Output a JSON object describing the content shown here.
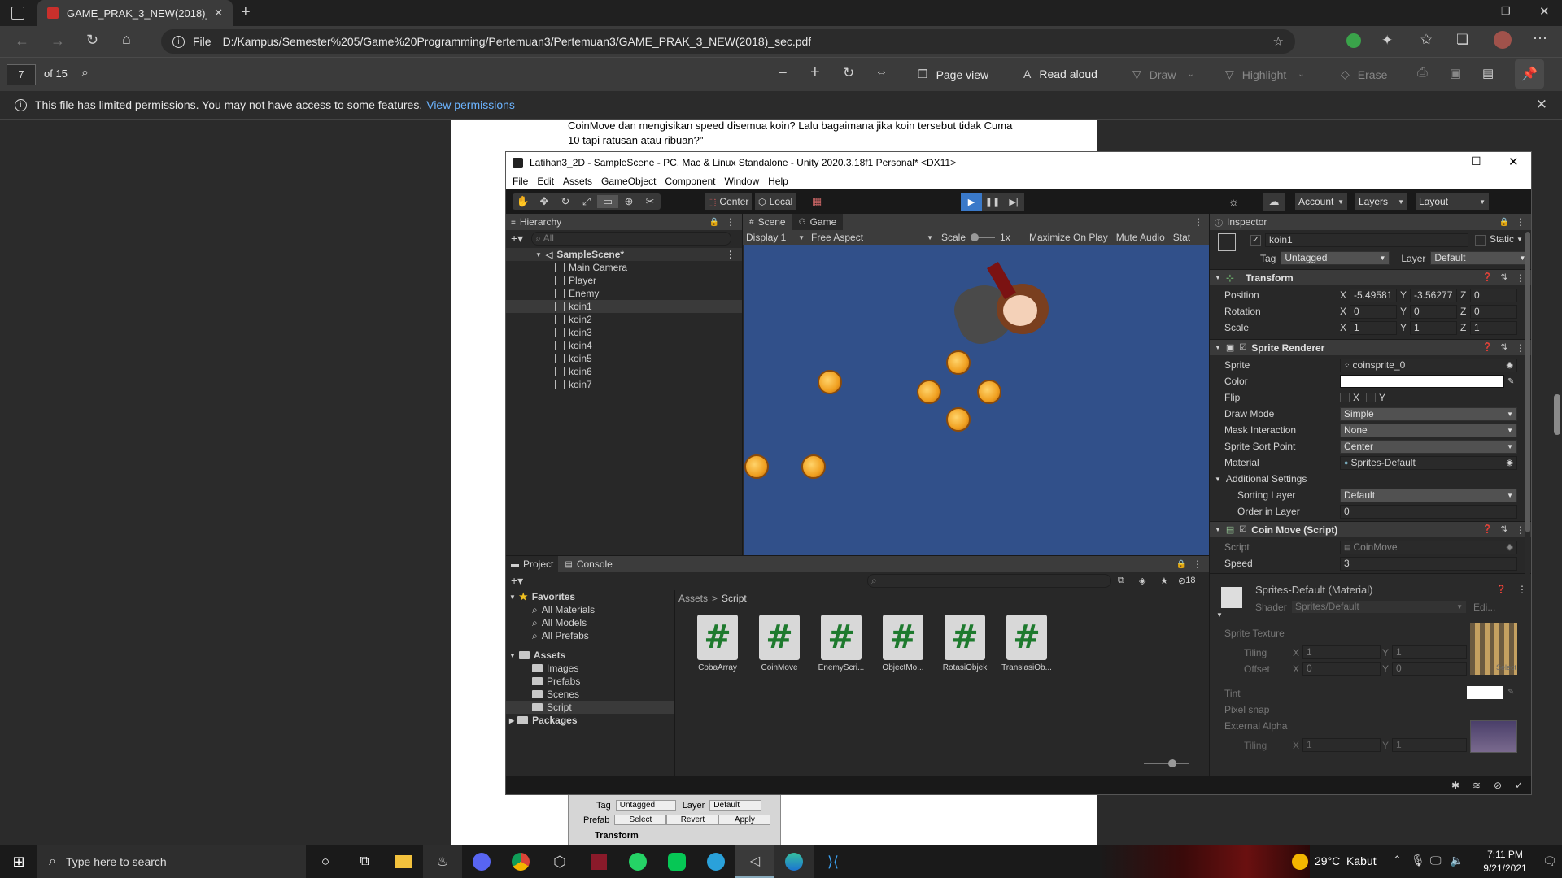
{
  "browser": {
    "tab_title": "GAME_PRAK_3_NEW(2018)_sec.p",
    "url_prefix": "File",
    "url": "D:/Kampus/Semester%205/Game%20Programming/Pertemuan3/Pertemuan3/GAME_PRAK_3_NEW(2018)_sec.pdf"
  },
  "pdf_toolbar": {
    "page_number": "7",
    "page_total": "of 15",
    "page_view": "Page view",
    "read_aloud": "Read aloud",
    "draw": "Draw",
    "highlight": "Highlight",
    "erase": "Erase"
  },
  "permission_bar": {
    "message": "This file has limited permissions. You may not have access to some features.",
    "link": "View permissions"
  },
  "pdf_page": {
    "text_line1": "CoinMove dan mengisikan speed disemua koin? Lalu bagaimana jika koin tersebut tidak Cuma",
    "text_line2": "10 tapi ratusan atau ribuan?\"",
    "bottom_tag_label": "Tag",
    "bottom_tag_value": "Untagged",
    "bottom_layer_label": "Layer",
    "bottom_layer_value": "Default",
    "bottom_prefab_label": "Prefab",
    "bottom_select": "Select",
    "bottom_revert": "Revert",
    "bottom_apply": "Apply",
    "bottom_transform": "Transform"
  },
  "unity": {
    "title": "Latihan3_2D - SampleScene - PC, Mac & Linux Standalone - Unity 2020.3.18f1 Personal* <DX11>",
    "menu": [
      "File",
      "Edit",
      "Assets",
      "GameObject",
      "Component",
      "Window",
      "Help"
    ],
    "toolbar": {
      "center": "Center",
      "local": "Local",
      "account": "Account",
      "layers": "Layers",
      "layout": "Layout"
    },
    "hierarchy": {
      "title": "Hierarchy",
      "search_placeholder": "All",
      "scene": "SampleScene*",
      "items": [
        "Main Camera",
        "Player",
        "Enemy",
        "koin1",
        "koin2",
        "koin3",
        "koin4",
        "koin5",
        "koin6",
        "koin7"
      ]
    },
    "game_view": {
      "tab_scene": "Scene",
      "tab_game": "Game",
      "display": "Display 1",
      "aspect": "Free Aspect",
      "scale_label": "Scale",
      "scale_value": "1x",
      "maximize": "Maximize On Play",
      "mute": "Mute Audio",
      "stats": "Stat",
      "background": "#31508a"
    },
    "project": {
      "tab_project": "Project",
      "tab_console": "Console",
      "favorites": "Favorites",
      "fav_items": [
        "All Materials",
        "All Models",
        "All Prefabs"
      ],
      "assets": "Assets",
      "asset_folders": [
        "Images",
        "Prefabs",
        "Scenes",
        "Script"
      ],
      "packages": "Packages",
      "breadcrumb_root": "Assets",
      "breadcrumb_leaf": "Script",
      "count": "18",
      "scripts": [
        "CobaArray",
        "CoinMove",
        "EnemyScri...",
        "ObjectMo...",
        "RotasiObjek",
        "TranslasiOb..."
      ]
    },
    "inspector": {
      "title": "Inspector",
      "object_name": "koin1",
      "static": "Static",
      "tag_label": "Tag",
      "tag_value": "Untagged",
      "layer_label": "Layer",
      "layer_value": "Default",
      "transform": {
        "title": "Transform",
        "position_label": "Position",
        "pos_x": "-5.49581",
        "pos_y": "-3.56277",
        "pos_z": "0",
        "rotation_label": "Rotation",
        "rot_x": "0",
        "rot_y": "0",
        "rot_z": "0",
        "scale_label": "Scale",
        "scale_x": "1",
        "scale_y": "1",
        "scale_z": "1"
      },
      "sprite_renderer": {
        "title": "Sprite Renderer",
        "sprite_label": "Sprite",
        "sprite_value": "coinsprite_0",
        "color_label": "Color",
        "flip_label": "Flip",
        "flip_x": "X",
        "flip_y": "Y",
        "draw_mode_label": "Draw Mode",
        "draw_mode_value": "Simple",
        "mask_label": "Mask Interaction",
        "mask_value": "None",
        "sort_point_label": "Sprite Sort Point",
        "sort_point_value": "Center",
        "material_label": "Material",
        "material_value": "Sprites-Default",
        "additional": "Additional Settings",
        "sorting_layer_label": "Sorting Layer",
        "sorting_layer_value": "Default",
        "order_label": "Order in Layer",
        "order_value": "0"
      },
      "coin_move": {
        "title": "Coin Move (Script)",
        "script_label": "Script",
        "script_value": "CoinMove",
        "speed_label": "Speed",
        "speed_value": "3"
      },
      "material": {
        "title": "Sprites-Default (Material)",
        "shader_label": "Shader",
        "shader_value": "Sprites/Default",
        "edit": "Edi...",
        "sprite_texture": "Sprite Texture",
        "tiling": "Tiling",
        "tiling_x": "1",
        "tiling_y": "1",
        "offset": "Offset",
        "offset_x": "0",
        "offset_y": "0",
        "select": "Select",
        "tint": "Tint",
        "pixel_snap": "Pixel snap",
        "external_alpha": "External Alpha",
        "tiling2": "Tiling",
        "tiling2_x": "1",
        "tiling2_y": "1"
      }
    }
  },
  "taskbar": {
    "search_placeholder": "Type here to search",
    "weather": "29°C  Kabut",
    "time": "7:11 PM",
    "date": "9/21/2021"
  }
}
